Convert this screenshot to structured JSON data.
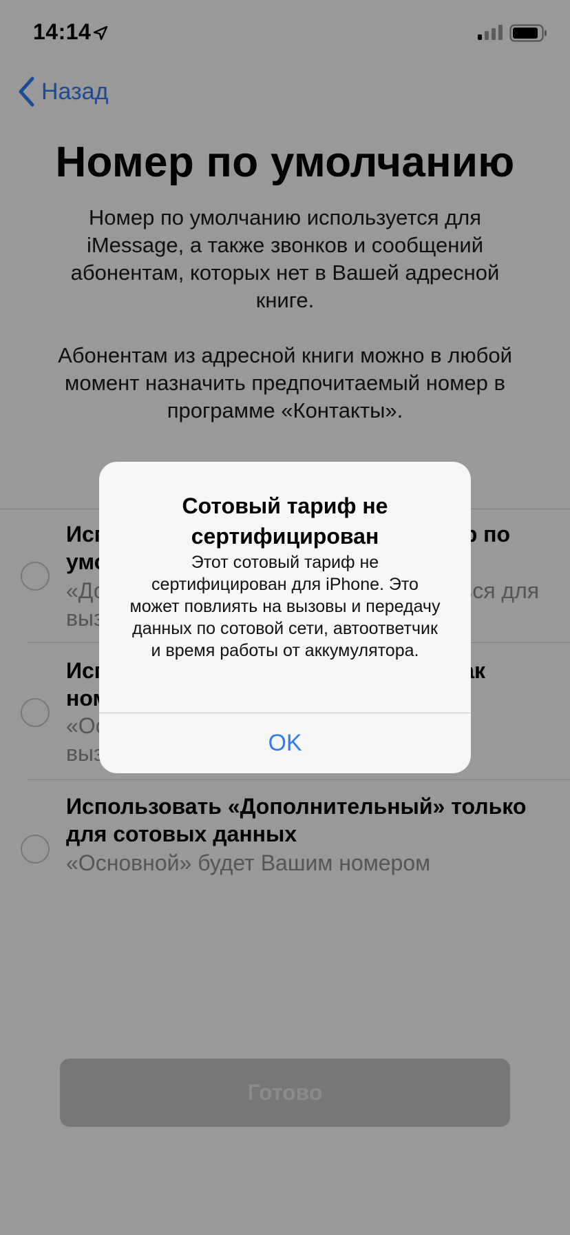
{
  "status_bar": {
    "time": "14:14"
  },
  "nav": {
    "back_label": "Назад"
  },
  "page": {
    "title": "Номер по умолчанию",
    "description_1": "Номер по умолчанию используется для iMessage, а также звонков и сообщений абонентам, которых нет в Вашей адресной книге.",
    "description_2": "Абонентам из адресной книги можно в любой момент назначить предпочитаемый номер в программе «Контакты»."
  },
  "options": [
    {
      "title": "Использовать «Основной» как номер по умолчанию",
      "subtitle": "«Дополнительный» будет использоваться для вызовов и SMS"
    },
    {
      "title": "Использовать «Дополнительный» как номер по умолчанию",
      "subtitle": "«Основной» будет использоваться для вызовов и SMS"
    },
    {
      "title": "Использовать «Дополнительный» только для сотовых данных",
      "subtitle": "«Основной» будет Вашим номером"
    }
  ],
  "done_button": {
    "label": "Готово"
  },
  "alert": {
    "title": "Сотовый тариф не сертифицирован",
    "message": "Этот сотовый тариф не сертифицирован для iPhone. Это может повлиять на вызовы и передачу данных по сотовой сети, автоответчик и время работы от аккумулятора.",
    "ok_label": "OK"
  },
  "colors": {
    "accent": "#2f7cf6",
    "dim_overlay": "rgba(0,0,0,0.40)"
  },
  "icons": [
    "location-arrow-icon",
    "cellular-signal-icon",
    "battery-icon",
    "chevron-left-icon"
  ]
}
